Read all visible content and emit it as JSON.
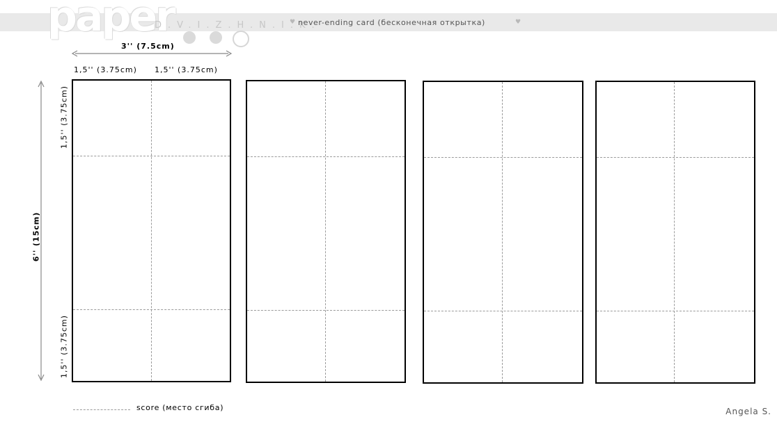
{
  "header": {
    "logo_word": "paper",
    "logo_sub": "D.V.I.Z.H.N.I.K.",
    "title": "never-ending card  (бесконечная открытка)",
    "heart_glyph": "♥"
  },
  "dimensions": {
    "total_width": "3'' (7.5cm)",
    "half_width_left": "1,5'' (3.75cm)",
    "half_width_right": "1,5'' (3.75cm)",
    "total_height": "6'' (15cm)",
    "top_section": "1,5'' (3.75cm)",
    "bottom_section": "1,5'' (3.75cm)"
  },
  "cards": [
    {
      "id": "card-1"
    },
    {
      "id": "card-2"
    },
    {
      "id": "card-3"
    },
    {
      "id": "card-4"
    }
  ],
  "legend": {
    "score_label": "score (место сгиба)"
  },
  "author": "Angela S.",
  "colors": {
    "header_band": "#e9e9e9",
    "score_line": "#9a9a9a",
    "card_border": "#000000",
    "arrow": "#888888"
  }
}
